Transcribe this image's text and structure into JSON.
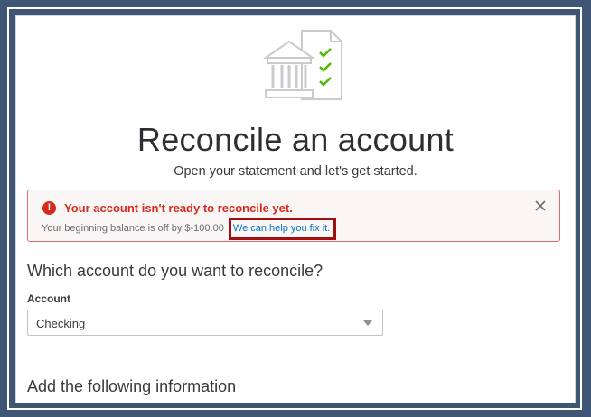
{
  "page": {
    "title": "Reconcile an account",
    "subtitle": "Open your statement and let's get started."
  },
  "alert": {
    "title": "Your account isn't ready to reconcile yet.",
    "body": "Your beginning balance is off by $-100.00",
    "link": "We can help you fix it.",
    "icon": "error-icon",
    "close_icon": "close-icon",
    "color": "#d52b1e",
    "highlight_color": "#a00f0f"
  },
  "account_section": {
    "question": "Which account do you want to reconcile?",
    "label": "Account",
    "selected": "Checking"
  },
  "info_section": {
    "heading": "Add the following information"
  },
  "colors": {
    "background": "#3e5573",
    "link": "#0077c5",
    "check": "#53b700"
  }
}
